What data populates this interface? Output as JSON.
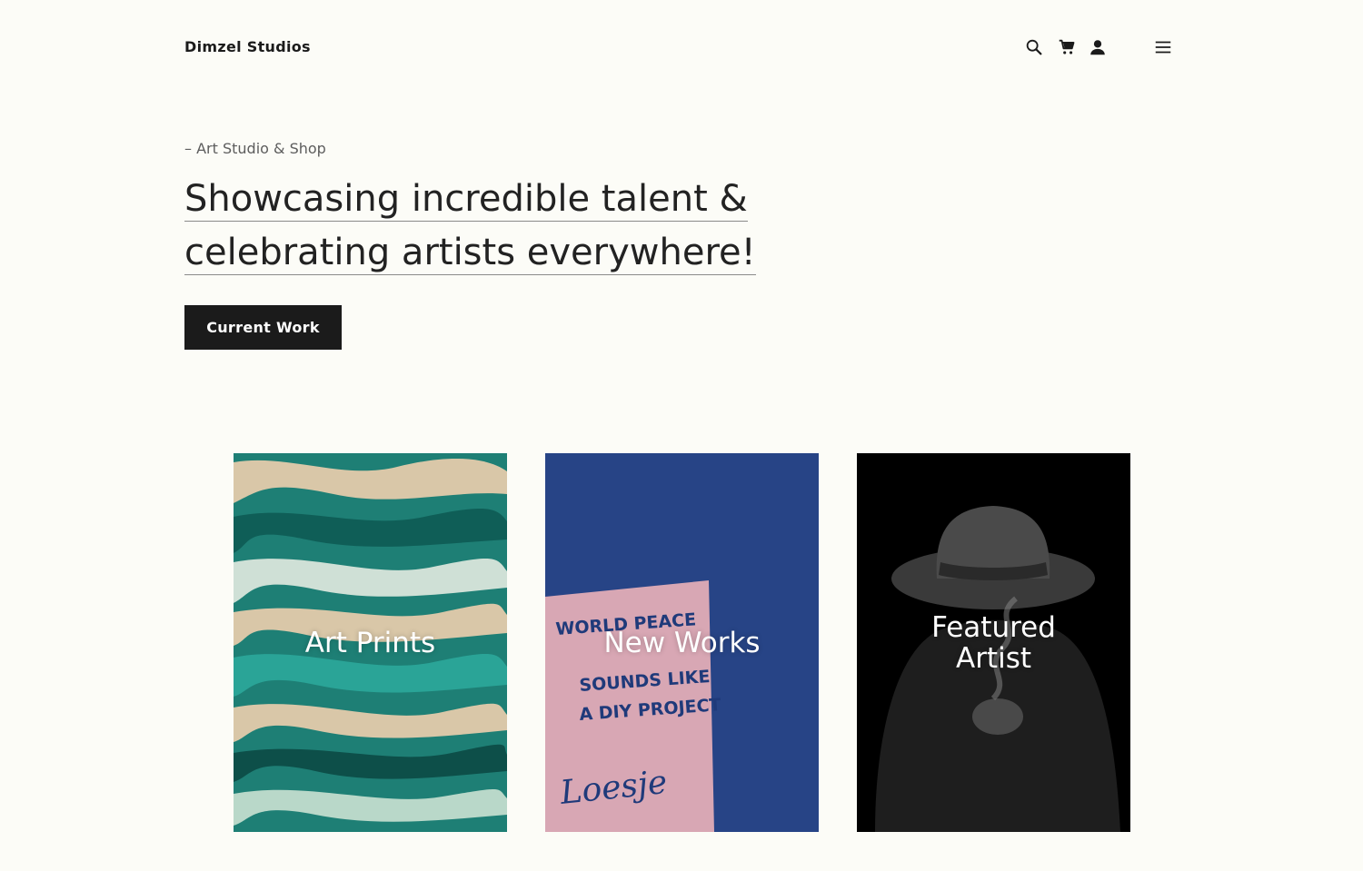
{
  "header": {
    "brand": "Dimzel Studios",
    "icons": [
      "search-icon",
      "cart-icon",
      "account-icon",
      "menu-icon"
    ]
  },
  "hero": {
    "eyebrow": "– Art Studio & Shop",
    "headline_line1": "Showcasing incredible talent &",
    "headline_line2": "celebrating artists everywhere!",
    "cta_label": "Current Work"
  },
  "cards": [
    {
      "label": "Art Prints"
    },
    {
      "label": "New Works",
      "poster_lines": [
        "WORLD PEACE",
        "SOUNDS LIKE",
        "A DIY PROJECT"
      ],
      "signature": "Loesje"
    },
    {
      "label": "Featured\nArtist"
    }
  ],
  "colors": {
    "background": "#fcfcf7",
    "button": "#1b1b1b",
    "card1": "#1e7f75",
    "card2": "#2b4a8c",
    "card3": "#000000"
  }
}
